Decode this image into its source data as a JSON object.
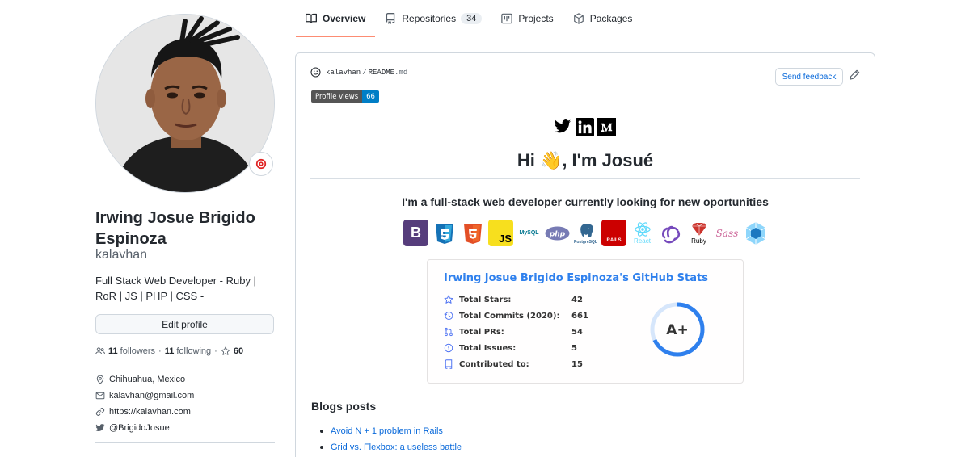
{
  "nav": {
    "tabs": [
      {
        "label": "Overview",
        "icon": "book-icon",
        "active": true
      },
      {
        "label": "Repositories",
        "icon": "repo-icon",
        "count": "34"
      },
      {
        "label": "Projects",
        "icon": "project-icon"
      },
      {
        "label": "Packages",
        "icon": "package-icon"
      }
    ]
  },
  "profile": {
    "full_name": "Irwing Josue Brigido Espinoza",
    "username": "kalavhan",
    "bio": "Full Stack Web Developer - Ruby | RoR | JS | PHP | CSS -",
    "edit_label": "Edit profile",
    "followers_count": "11",
    "followers_label": "followers",
    "following_count": "11",
    "following_label": "following",
    "stars_count": "60",
    "location": "Chihuahua, Mexico",
    "email": "kalavhan@gmail.com",
    "website": "https://kalavhan.com",
    "twitter": "@BrigidoJosue"
  },
  "readme": {
    "owner": "kalavhan",
    "separator": "/",
    "file_name": "README",
    "file_ext": ".md",
    "feedback_label": "Send feedback",
    "badge_label": "Profile views",
    "badge_value": "66",
    "social_icons": [
      "twitter-icon",
      "linkedin-icon",
      "medium-icon"
    ],
    "greeting": "Hi 👋, I'm Josué",
    "subtitle": "I'm a full-stack web developer currently looking for new oportunities",
    "techs": [
      {
        "name": "bootstrap",
        "glyph": "B",
        "color": "#563d7c"
      },
      {
        "name": "css3",
        "glyph": "3",
        "color": "#1572b6"
      },
      {
        "name": "html5",
        "glyph": "5",
        "color": "#e34f26"
      },
      {
        "name": "javascript",
        "glyph": "JS",
        "color": "#f7df1e"
      },
      {
        "name": "mysql",
        "glyph": "MySQL",
        "color": "#00758f"
      },
      {
        "name": "php",
        "glyph": "php",
        "color": "#777bb4"
      },
      {
        "name": "postgresql",
        "glyph": "PostgreSQL",
        "color": "#336791"
      },
      {
        "name": "rails",
        "glyph": "RAILS",
        "color": "#cc0000"
      },
      {
        "name": "react",
        "glyph": "React",
        "color": "#61dafb"
      },
      {
        "name": "redux",
        "glyph": "",
        "color": "#764abc"
      },
      {
        "name": "ruby",
        "glyph": "Ruby",
        "color": "#cc342d"
      },
      {
        "name": "sass",
        "glyph": "Sass",
        "color": "#cc6699"
      },
      {
        "name": "webpack",
        "glyph": "",
        "color": "#8ed6fb"
      }
    ],
    "stats": {
      "title": "Irwing Josue Brigido Espinoza's GitHub Stats",
      "rows": [
        {
          "label": "Total Stars:",
          "value": "42",
          "icon": "star-icon"
        },
        {
          "label": "Total Commits (2020):",
          "value": "661",
          "icon": "history-icon"
        },
        {
          "label": "Total PRs:",
          "value": "54",
          "icon": "pull-request-icon"
        },
        {
          "label": "Total Issues:",
          "value": "5",
          "icon": "issue-icon"
        },
        {
          "label": "Contributed to:",
          "value": "15",
          "icon": "repo-icon"
        }
      ],
      "grade": "A+",
      "grade_progress": 0.68,
      "accent": "#2f80ed"
    },
    "blog_title": "Blogs posts",
    "blog_posts": [
      "Avoid N + 1 problem in Rails",
      "Grid vs. Flexbox: a useless battle"
    ]
  }
}
